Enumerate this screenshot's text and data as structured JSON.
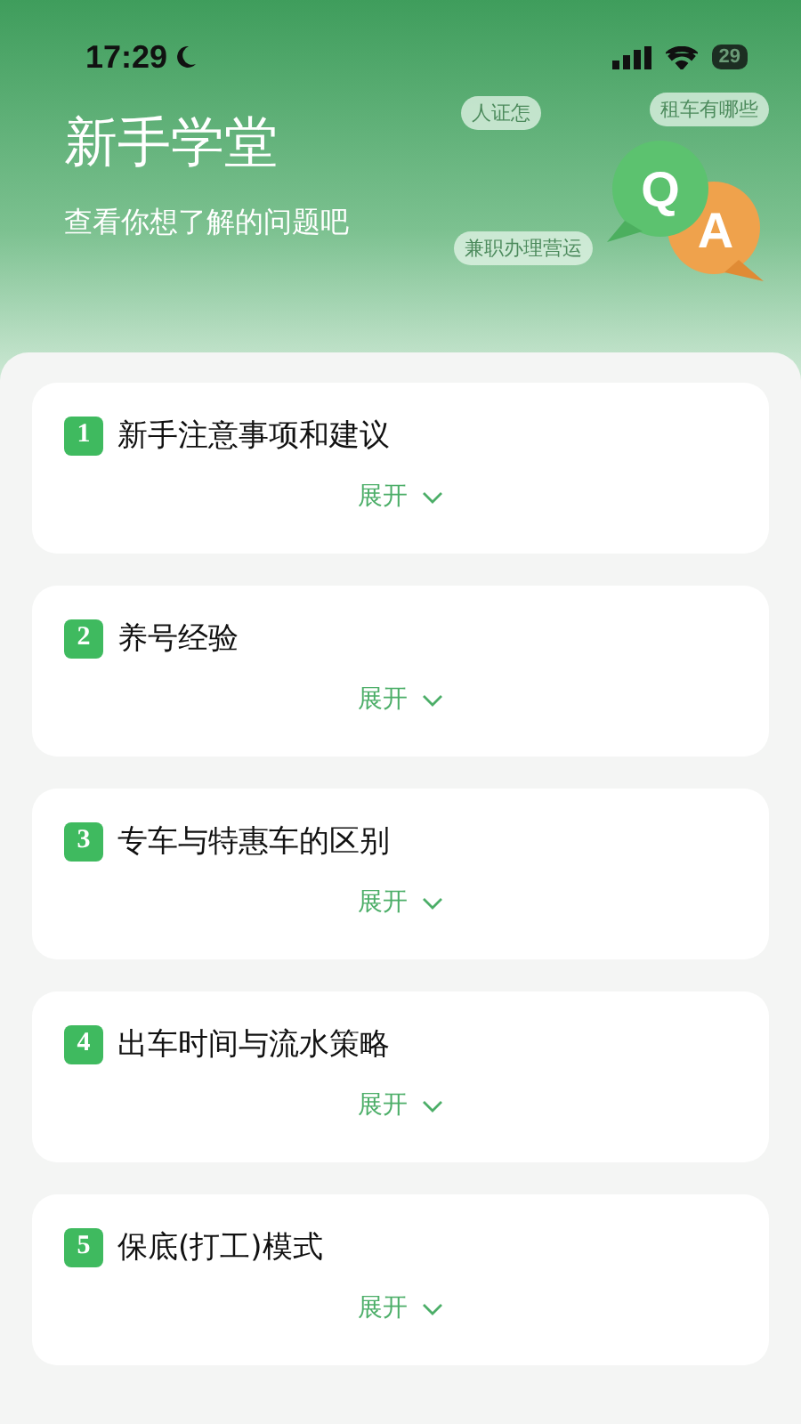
{
  "status_bar": {
    "time": "17:29",
    "battery": "29"
  },
  "header": {
    "title": "新手学堂",
    "subtitle": "查看你想了解的问题吧",
    "illustration": {
      "tags": [
        "人证怎",
        "租车有哪些",
        "兼职办理营运"
      ],
      "q": "Q",
      "a": "A"
    }
  },
  "questions": [
    {
      "number": "1",
      "title": "新手注意事项和建议",
      "toggle": "展开",
      "expanded": false
    },
    {
      "number": "2",
      "title": "养号经验",
      "toggle": "展开",
      "expanded": false
    },
    {
      "number": "3",
      "title": "专车与特惠车的区别",
      "toggle": "展开",
      "expanded": false
    },
    {
      "number": "4",
      "title": "出车时间与流水策略",
      "toggle": "展开",
      "expanded": false
    },
    {
      "number": "5",
      "title": "保底(打工)模式",
      "toggle": "展开",
      "expanded": false
    }
  ]
}
